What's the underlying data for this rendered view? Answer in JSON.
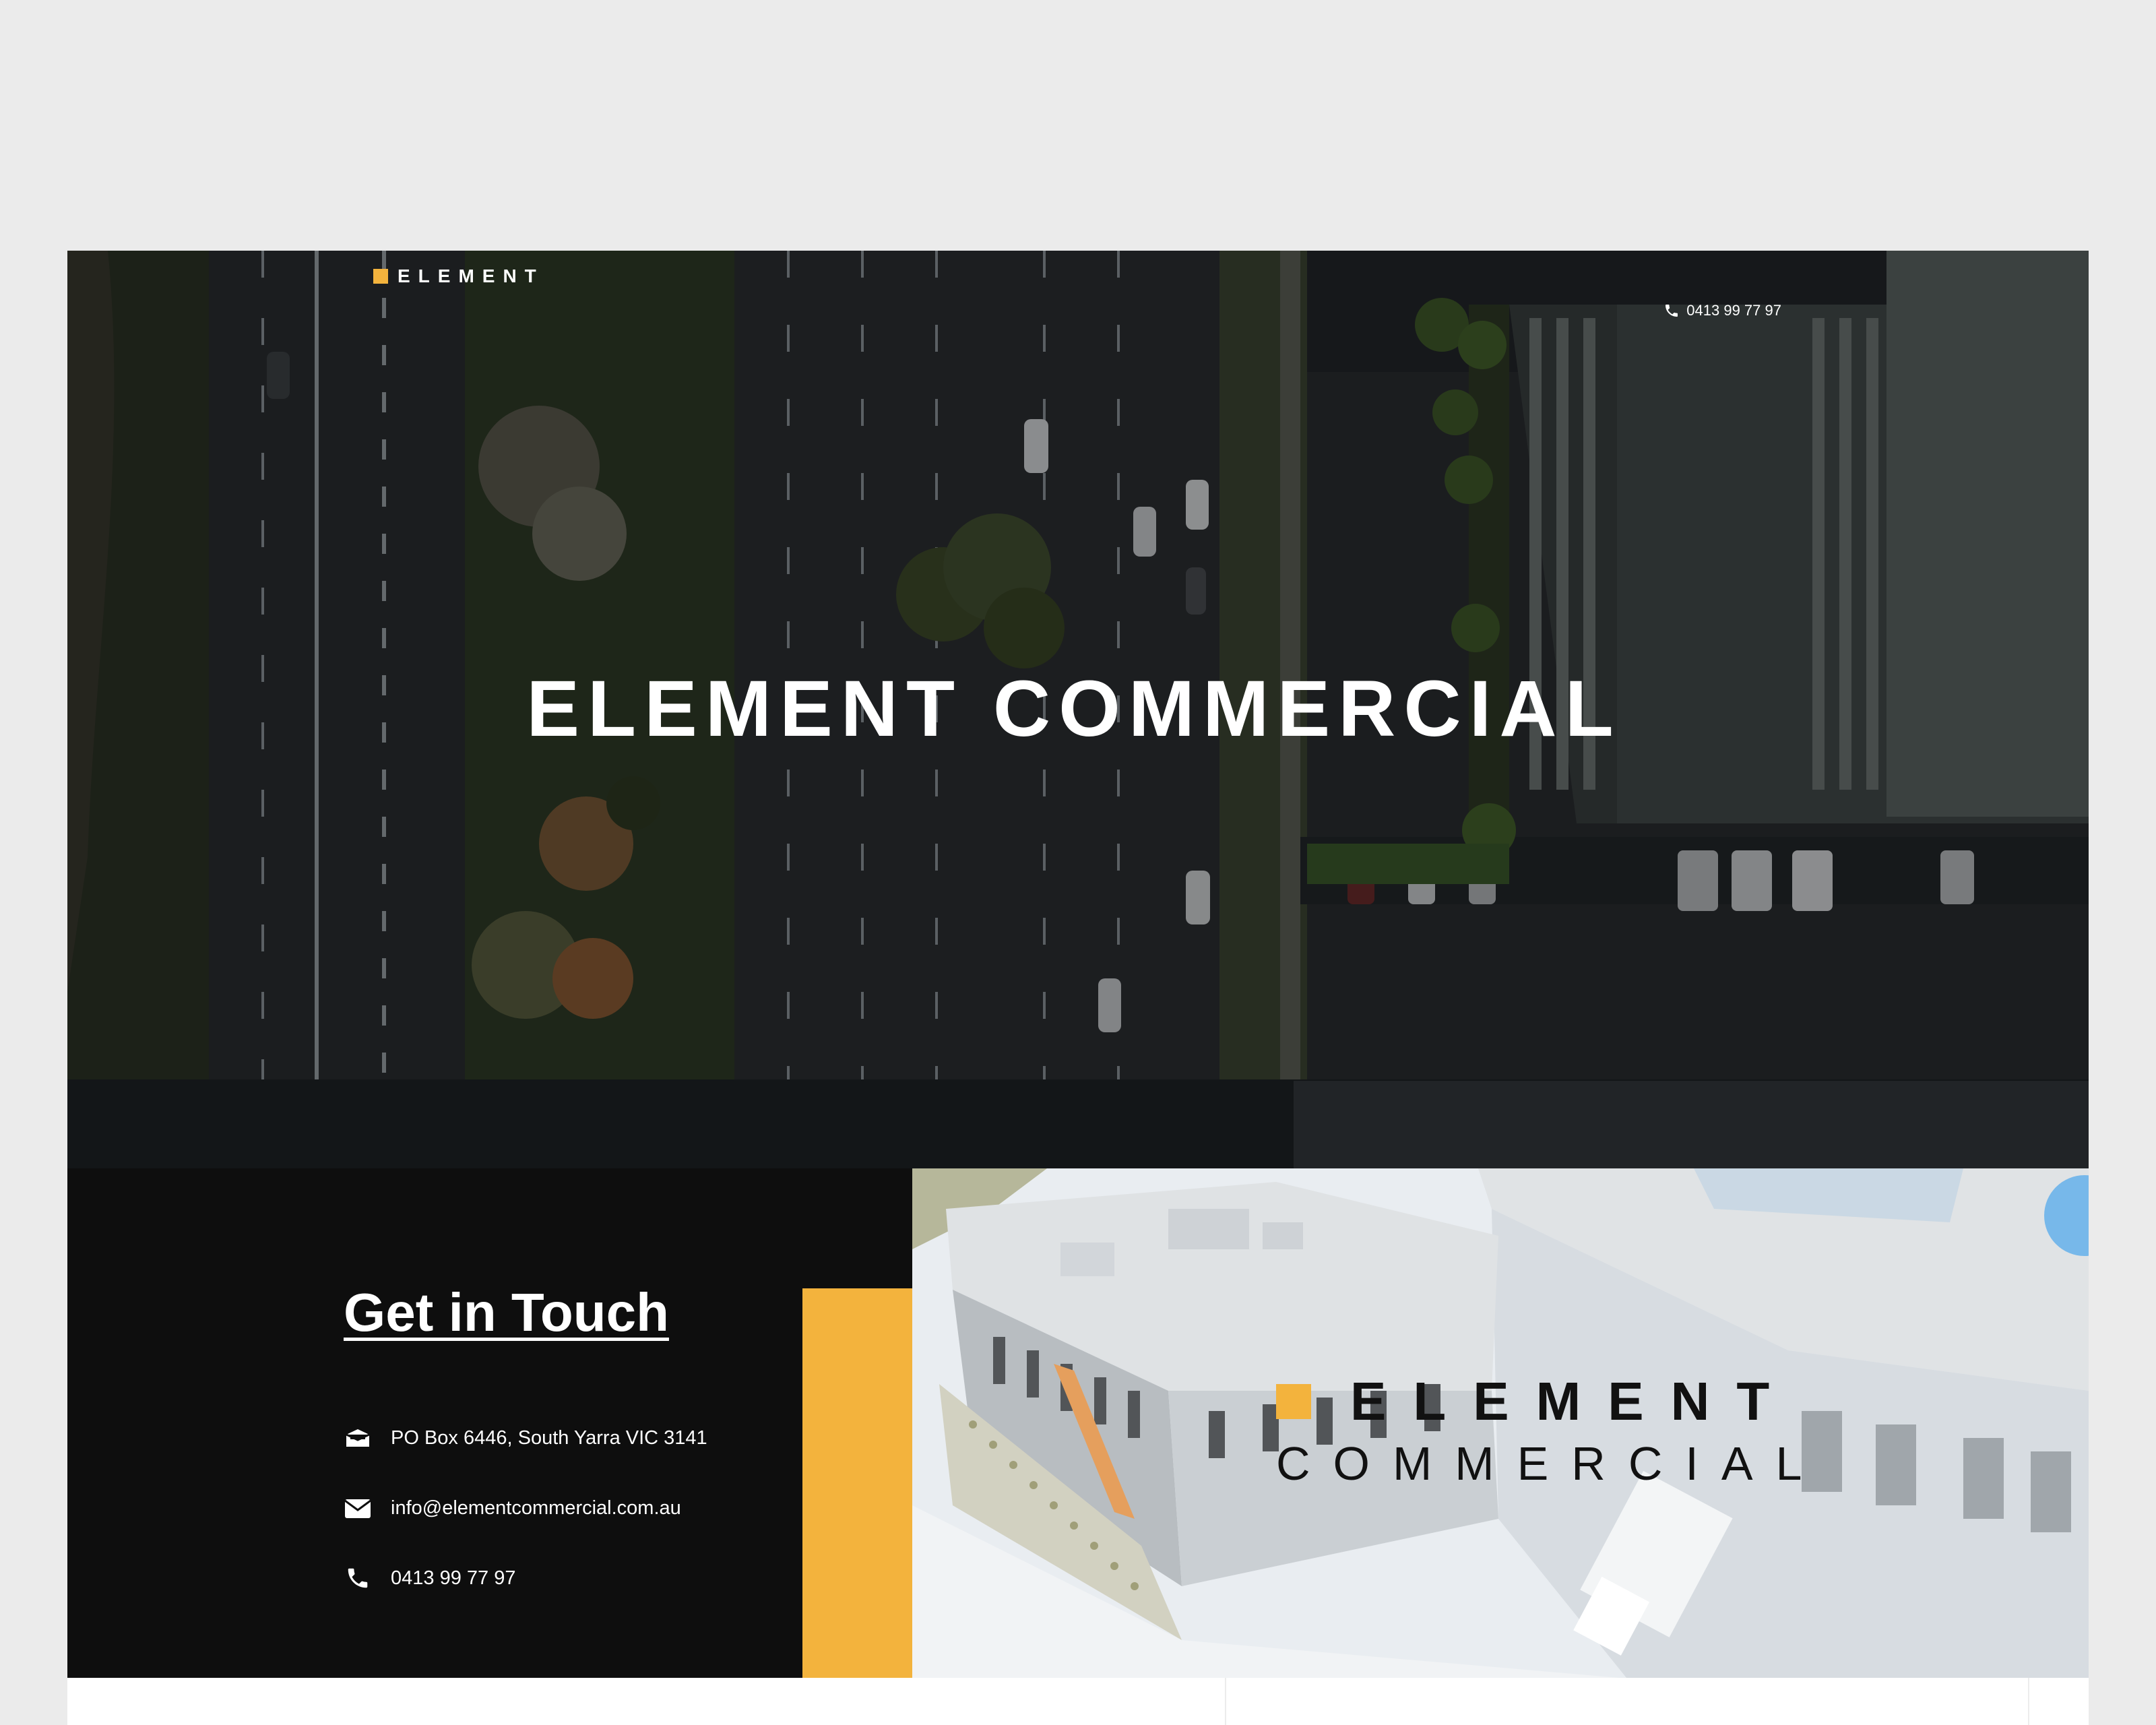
{
  "header": {
    "brand_name": "ELEMENT",
    "phone": "0413 99 77 97",
    "phone_icon": "phone-icon"
  },
  "hero": {
    "title": "ELEMENT COMMERCIAL"
  },
  "contact": {
    "title": "Get in Touch",
    "items": [
      {
        "icon": "mailbox-icon",
        "text": "PO Box 6446, South Yarra VIC 3141"
      },
      {
        "icon": "envelope-icon",
        "text": "info@elementcommercial.com.au"
      },
      {
        "icon": "phone-icon",
        "text": "0413 99 77 97"
      }
    ]
  },
  "logo": {
    "word": "ELEMENT",
    "sub": "COMMERCIAL"
  },
  "colors": {
    "accent": "#f3b33d",
    "dark": "#0e0e0e",
    "page_bg": "#ebebeb"
  }
}
